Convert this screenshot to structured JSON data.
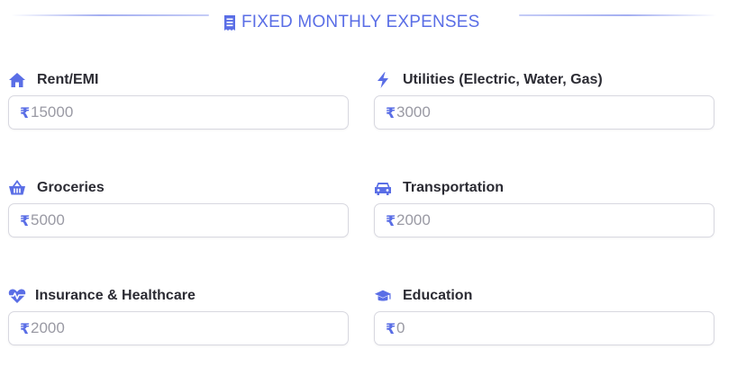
{
  "section": {
    "title": "FIXED MONTHLY EXPENSES",
    "icon": "receipt-icon",
    "accent_color": "#5a6ee6"
  },
  "currency_symbol": "₹",
  "fields": [
    {
      "label": "Rent/EMI",
      "icon": "home-icon",
      "placeholder": "15000"
    },
    {
      "label": "Utilities (Electric, Water, Gas)",
      "icon": "bolt-icon",
      "placeholder": "3000"
    },
    {
      "label": "Groceries",
      "icon": "basket-icon",
      "placeholder": "5000"
    },
    {
      "label": "Transportation",
      "icon": "car-icon",
      "placeholder": "2000"
    },
    {
      "label": "Insurance & Healthcare",
      "icon": "heartbeat-icon",
      "placeholder": "2000"
    },
    {
      "label": "Education",
      "icon": "graduation-cap-icon",
      "placeholder": "0"
    }
  ]
}
